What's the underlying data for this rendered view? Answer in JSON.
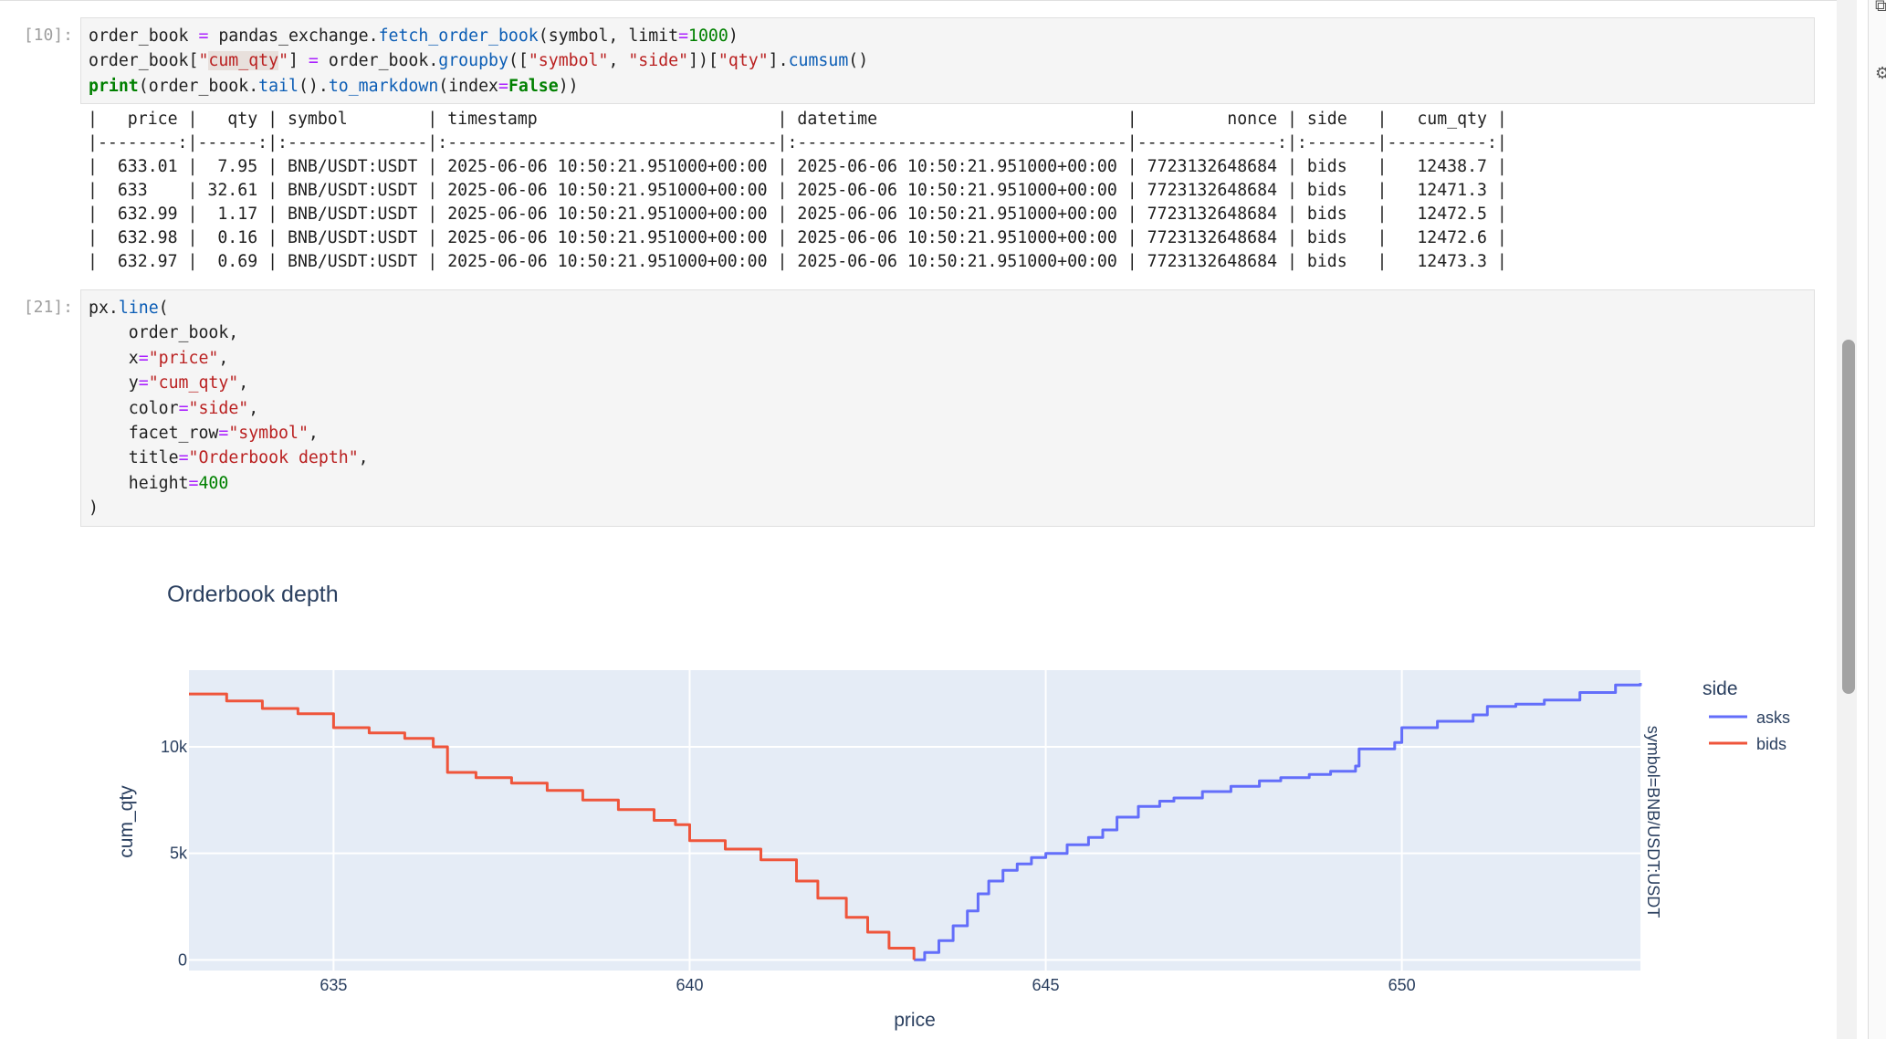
{
  "cells": [
    {
      "prompt": "[10]:",
      "code_lines": [
        [
          {
            "t": "order_book "
          },
          {
            "t": "=",
            "c": "op"
          },
          {
            "t": " pandas_exchange."
          },
          {
            "t": "fetch_order_book",
            "c": "fn"
          },
          {
            "t": "(symbol, limit"
          },
          {
            "t": "=",
            "c": "op"
          },
          {
            "t": "1000",
            "c": "num"
          },
          {
            "t": ")"
          }
        ],
        [
          {
            "t": "order_book["
          },
          {
            "t": "\"",
            "c": "str"
          },
          {
            "t": "cum_qty",
            "c": "str-hl"
          },
          {
            "t": "\"",
            "c": "str"
          },
          {
            "t": "] "
          },
          {
            "t": "=",
            "c": "op"
          },
          {
            "t": " order_book."
          },
          {
            "t": "groupby",
            "c": "fn"
          },
          {
            "t": "(["
          },
          {
            "t": "\"symbol\"",
            "c": "str"
          },
          {
            "t": ", "
          },
          {
            "t": "\"side\"",
            "c": "str"
          },
          {
            "t": "])["
          },
          {
            "t": "\"qty\"",
            "c": "str"
          },
          {
            "t": "]."
          },
          {
            "t": "cumsum",
            "c": "fn"
          },
          {
            "t": "()"
          }
        ],
        [
          {
            "t": "print",
            "c": "kw"
          },
          {
            "t": "(order_book."
          },
          {
            "t": "tail",
            "c": "fn"
          },
          {
            "t": "()."
          },
          {
            "t": "to_markdown",
            "c": "fn"
          },
          {
            "t": "(index"
          },
          {
            "t": "=",
            "c": "op"
          },
          {
            "t": "False",
            "c": "kw"
          },
          {
            "t": "))"
          }
        ]
      ],
      "output_lines": [
        "|   price |   qty | symbol        | timestamp                        | datetime                         |         nonce | side   |   cum_qty |",
        "|--------:|------:|:--------------|:---------------------------------|:---------------------------------|--------------:|:-------|----------:|",
        "|  633.01 |  7.95 | BNB/USDT:USDT | 2025-06-06 10:50:21.951000+00:00 | 2025-06-06 10:50:21.951000+00:00 | 7723132648684 | bids   |   12438.7 |",
        "|  633    | 32.61 | BNB/USDT:USDT | 2025-06-06 10:50:21.951000+00:00 | 2025-06-06 10:50:21.951000+00:00 | 7723132648684 | bids   |   12471.3 |",
        "|  632.99 |  1.17 | BNB/USDT:USDT | 2025-06-06 10:50:21.951000+00:00 | 2025-06-06 10:50:21.951000+00:00 | 7723132648684 | bids   |   12472.5 |",
        "|  632.98 |  0.16 | BNB/USDT:USDT | 2025-06-06 10:50:21.951000+00:00 | 2025-06-06 10:50:21.951000+00:00 | 7723132648684 | bids   |   12472.6 |",
        "|  632.97 |  0.69 | BNB/USDT:USDT | 2025-06-06 10:50:21.951000+00:00 | 2025-06-06 10:50:21.951000+00:00 | 7723132648684 | bids   |   12473.3 |"
      ]
    },
    {
      "prompt": "[21]:",
      "code_lines": [
        [
          {
            "t": "px."
          },
          {
            "t": "line",
            "c": "fn"
          },
          {
            "t": "("
          }
        ],
        [
          {
            "t": "    order_book,"
          }
        ],
        [
          {
            "t": "    x"
          },
          {
            "t": "=",
            "c": "op"
          },
          {
            "t": "\"price\"",
            "c": "str"
          },
          {
            "t": ","
          }
        ],
        [
          {
            "t": "    y"
          },
          {
            "t": "=",
            "c": "op"
          },
          {
            "t": "\"cum_qty\"",
            "c": "str"
          },
          {
            "t": ","
          }
        ],
        [
          {
            "t": "    color"
          },
          {
            "t": "=",
            "c": "op"
          },
          {
            "t": "\"side\"",
            "c": "str"
          },
          {
            "t": ","
          }
        ],
        [
          {
            "t": "    facet_row"
          },
          {
            "t": "=",
            "c": "op"
          },
          {
            "t": "\"symbol\"",
            "c": "str"
          },
          {
            "t": ","
          }
        ],
        [
          {
            "t": "    title"
          },
          {
            "t": "=",
            "c": "op"
          },
          {
            "t": "\"Orderbook depth\"",
            "c": "str"
          },
          {
            "t": ","
          }
        ],
        [
          {
            "t": "    height"
          },
          {
            "t": "=",
            "c": "op"
          },
          {
            "t": "400",
            "c": "num"
          }
        ],
        [
          {
            "t": ")"
          }
        ]
      ]
    }
  ],
  "colors": {
    "fn": "#0b5db5",
    "str": "#ba2121",
    "num": "#008000",
    "kw": "#008000",
    "op": "#aa22ff",
    "plot_bg": "#e5ecf6",
    "asks": "#636efa",
    "bids": "#ef553b",
    "text": "#2a3f5f"
  },
  "icons": {
    "right_edge_top": "copy-icon",
    "right_edge_mid": "settings-icon"
  },
  "chart_data": {
    "type": "line",
    "title": "Orderbook depth",
    "xlabel": "price",
    "ylabel": "cum_qty",
    "xlim": [
      632.97,
      653.35
    ],
    "ylim": [
      -500,
      13600
    ],
    "xticks": [
      635,
      640,
      645,
      650
    ],
    "xtick_labels": [
      "635",
      "640",
      "645",
      "650"
    ],
    "yticks": [
      0,
      5000,
      10000
    ],
    "ytick_labels": [
      "0",
      "5k",
      "10k"
    ],
    "grid": true,
    "facet_label": "symbol=BNB/USDT:USDT",
    "legend_title": "side",
    "legend_position": "right",
    "series": [
      {
        "name": "asks",
        "x": [
          643.15,
          643.3,
          643.5,
          643.7,
          643.9,
          644.05,
          644.2,
          644.4,
          644.6,
          644.8,
          645.0,
          645.3,
          645.6,
          645.8,
          646.0,
          646.3,
          646.6,
          646.8,
          647.2,
          647.6,
          648.0,
          648.3,
          648.7,
          649.0,
          649.35,
          649.4,
          649.9,
          650.0,
          650.5,
          651.0,
          651.2,
          651.6,
          652.0,
          652.5,
          653.0,
          653.35
        ],
        "y": [
          0,
          350,
          900,
          1600,
          2300,
          3100,
          3700,
          4200,
          4500,
          4800,
          5000,
          5400,
          5750,
          6100,
          6700,
          7200,
          7450,
          7600,
          7900,
          8150,
          8400,
          8550,
          8700,
          8850,
          9100,
          9900,
          10200,
          10900,
          11200,
          11500,
          11900,
          12000,
          12200,
          12550,
          12900,
          13000
        ]
      },
      {
        "name": "bids",
        "x": [
          632.97,
          633.5,
          634.0,
          634.5,
          635.0,
          635.5,
          636.0,
          636.4,
          636.6,
          637.0,
          637.5,
          638.0,
          638.5,
          639.0,
          639.5,
          639.8,
          640.0,
          640.5,
          641.0,
          641.5,
          641.8,
          642.2,
          642.5,
          642.8,
          643.15
        ],
        "y": [
          12480,
          12150,
          11800,
          11550,
          10900,
          10650,
          10400,
          10000,
          8800,
          8550,
          8300,
          7950,
          7500,
          7050,
          6550,
          6350,
          5600,
          5200,
          4700,
          3700,
          2900,
          2000,
          1300,
          550,
          0
        ]
      }
    ]
  }
}
